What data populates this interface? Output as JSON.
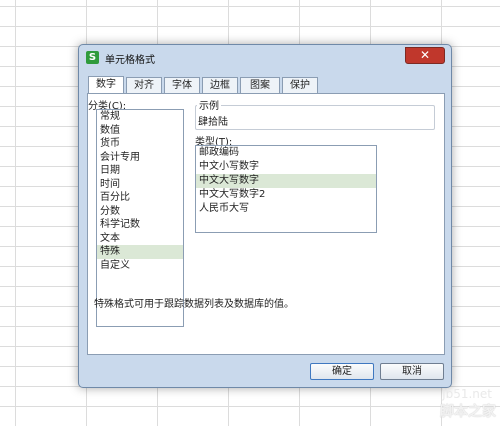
{
  "dialog": {
    "title": "单元格格式",
    "close_glyph": "✕"
  },
  "tabs": [
    {
      "label": "数字",
      "active": true
    },
    {
      "label": "对齐",
      "active": false
    },
    {
      "label": "字体",
      "active": false
    },
    {
      "label": "边框",
      "active": false
    },
    {
      "label": "图案",
      "active": false
    },
    {
      "label": "保护",
      "active": false
    }
  ],
  "category": {
    "label": "分类(C):",
    "items": [
      "常规",
      "数值",
      "货币",
      "会计专用",
      "日期",
      "时间",
      "百分比",
      "分数",
      "科学记数",
      "文本",
      "特殊",
      "自定义"
    ],
    "selected": "特殊"
  },
  "sample": {
    "legend": "示例",
    "value": "肆拾陆"
  },
  "type": {
    "label": "类型(T):",
    "items": [
      "邮政编码",
      "中文小写数字",
      "中文大写数字",
      "中文大写数字2",
      "人民币大写"
    ],
    "selected": "中文大写数字"
  },
  "description": "特殊格式可用于跟踪数据列表及数据库的值。",
  "buttons": {
    "ok": "确定",
    "cancel": "取消"
  },
  "watermark": {
    "site": "jb51.net",
    "name": "脚本之家"
  },
  "colors": {
    "dialog_bg": "#c9d9ec",
    "selection": "#dbe8d6",
    "close_red": "#c0372c",
    "app_icon_green": "#2f9b3c"
  },
  "icons": {
    "app": "wps-spreadsheet-icon",
    "close": "close-icon"
  }
}
